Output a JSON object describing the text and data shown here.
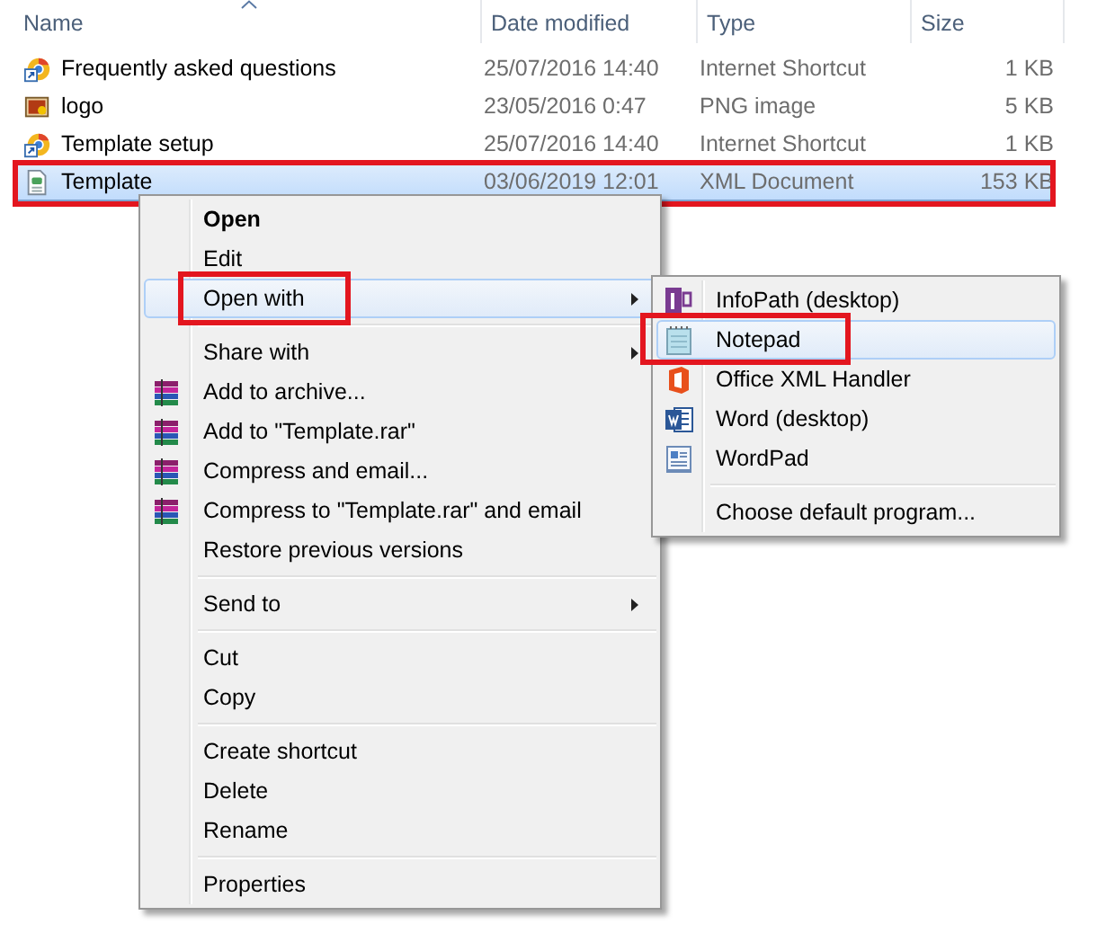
{
  "columns": [
    {
      "label": "Name",
      "sorted": true
    },
    {
      "label": "Date modified",
      "sorted": false
    },
    {
      "label": "Type",
      "sorted": false
    },
    {
      "label": "Size",
      "sorted": false
    }
  ],
  "files": [
    {
      "name": "Frequently asked questions",
      "date": "25/07/2016 14:40",
      "type": "Internet Shortcut",
      "size": "1 KB",
      "kind": "shortcut",
      "selected": false,
      "highlighted": false
    },
    {
      "name": "logo",
      "date": "23/05/2016 0:47",
      "type": "PNG image",
      "size": "5 KB",
      "kind": "image",
      "selected": false,
      "highlighted": false
    },
    {
      "name": "Template setup",
      "date": "25/07/2016 14:40",
      "type": "Internet Shortcut",
      "size": "1 KB",
      "kind": "shortcut",
      "selected": false,
      "highlighted": false
    },
    {
      "name": "Template",
      "date": "03/06/2019 12:01",
      "type": "XML Document",
      "size": "153 KB",
      "kind": "xml",
      "selected": true,
      "highlighted": true
    }
  ],
  "context_menu": [
    {
      "kind": "item",
      "label": "Open",
      "default": true,
      "submenu": false,
      "hovered": false,
      "highlighted": false
    },
    {
      "kind": "item",
      "label": "Edit",
      "default": false,
      "submenu": false,
      "hovered": false,
      "highlighted": false
    },
    {
      "kind": "item",
      "label": "Open with",
      "default": false,
      "submenu": true,
      "hovered": true,
      "highlighted": true
    },
    {
      "kind": "separator"
    },
    {
      "kind": "item",
      "label": "Share with",
      "default": false,
      "submenu": true,
      "hovered": false,
      "highlighted": false
    },
    {
      "kind": "archive",
      "label": "Add to archive...",
      "default": false,
      "submenu": false,
      "hovered": false,
      "highlighted": false
    },
    {
      "kind": "archive",
      "label": "Add to \"Template.rar\"",
      "default": false,
      "submenu": false,
      "hovered": false,
      "highlighted": false
    },
    {
      "kind": "archive",
      "label": "Compress and email...",
      "default": false,
      "submenu": false,
      "hovered": false,
      "highlighted": false
    },
    {
      "kind": "archive",
      "label": "Compress to \"Template.rar\" and email",
      "default": false,
      "submenu": false,
      "hovered": false,
      "highlighted": false
    },
    {
      "kind": "item",
      "label": "Restore previous versions",
      "default": false,
      "submenu": false,
      "hovered": false,
      "highlighted": false
    },
    {
      "kind": "separator"
    },
    {
      "kind": "item",
      "label": "Send to",
      "default": false,
      "submenu": true,
      "hovered": false,
      "highlighted": false
    },
    {
      "kind": "separator"
    },
    {
      "kind": "item",
      "label": "Cut",
      "default": false,
      "submenu": false,
      "hovered": false,
      "highlighted": false
    },
    {
      "kind": "item",
      "label": "Copy",
      "default": false,
      "submenu": false,
      "hovered": false,
      "highlighted": false
    },
    {
      "kind": "separator"
    },
    {
      "kind": "item",
      "label": "Create shortcut",
      "default": false,
      "submenu": false,
      "hovered": false,
      "highlighted": false
    },
    {
      "kind": "item",
      "label": "Delete",
      "default": false,
      "submenu": false,
      "hovered": false,
      "highlighted": false
    },
    {
      "kind": "item",
      "label": "Rename",
      "default": false,
      "submenu": false,
      "hovered": false,
      "highlighted": false
    },
    {
      "kind": "separator"
    },
    {
      "kind": "item",
      "label": "Properties",
      "default": false,
      "submenu": false,
      "hovered": false,
      "highlighted": false
    }
  ],
  "open_with_menu": [
    {
      "kind": "infopath",
      "label": "InfoPath (desktop)",
      "hovered": false,
      "highlighted": false
    },
    {
      "kind": "notepad",
      "label": "Notepad",
      "hovered": true,
      "highlighted": true
    },
    {
      "kind": "office",
      "label": "Office XML Handler",
      "hovered": false,
      "highlighted": false
    },
    {
      "kind": "word",
      "label": "Word (desktop)",
      "hovered": false,
      "highlighted": false
    },
    {
      "kind": "wordpad",
      "label": "WordPad",
      "hovered": false,
      "highlighted": false
    },
    {
      "kind": "separator"
    },
    {
      "kind": "item",
      "label": "Choose default program...",
      "hovered": false,
      "highlighted": false
    }
  ]
}
